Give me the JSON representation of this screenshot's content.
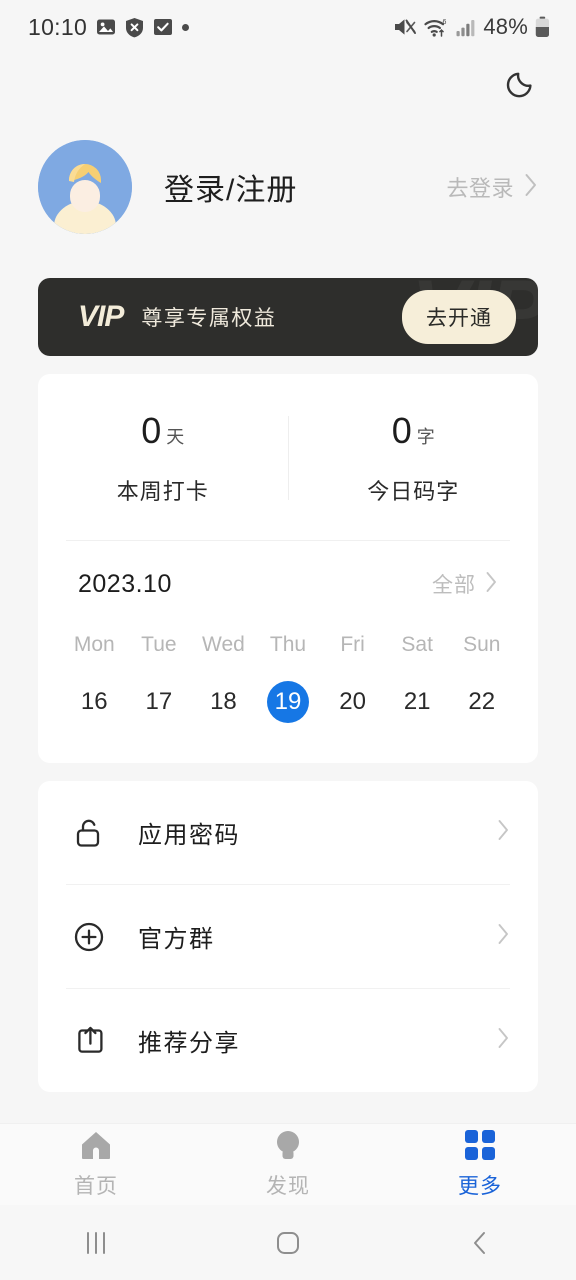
{
  "status_bar": {
    "time": "10:10",
    "left_icons": [
      "image-icon",
      "shield-x-icon",
      "checkbox-checked-icon",
      "dot-icon"
    ],
    "right_icons": [
      "mute-icon",
      "wifi6-icon",
      "signal-bars-icon",
      "battery-icon"
    ],
    "battery_text": "48%"
  },
  "header": {
    "theme_toggle_icon": "moon-icon"
  },
  "profile": {
    "avatar_icon": "default-user-avatar",
    "name": "登录/注册",
    "action_label": "去登录",
    "chevron_icon": "chevron-right-icon"
  },
  "vip": {
    "logo": "VIP",
    "watermark": "VIP",
    "subtitle": "尊享专属权益",
    "button_label": "去开通",
    "bg_color": "#2e2e2c",
    "button_color": "#f6eed9"
  },
  "stats": [
    {
      "value": "0",
      "unit": "天",
      "label": "本周打卡"
    },
    {
      "value": "0",
      "unit": "字",
      "label": "今日码字"
    }
  ],
  "calendar": {
    "month": "2023.10",
    "all_label": "全部",
    "all_chevron_icon": "chevron-right-icon",
    "weekdays": [
      "Mon",
      "Tue",
      "Wed",
      "Thu",
      "Fri",
      "Sat",
      "Sun"
    ],
    "days": [
      "16",
      "17",
      "18",
      "19",
      "20",
      "21",
      "22"
    ],
    "selected_day": "19",
    "selected_color": "#1677e5"
  },
  "menu": [
    {
      "icon": "lock-open-icon",
      "label": "应用密码",
      "chevron": "chevron-right-icon"
    },
    {
      "icon": "plus-circle-icon",
      "label": "官方群",
      "chevron": "chevron-right-icon"
    },
    {
      "icon": "share-icon",
      "label": "推荐分享",
      "chevron": "chevron-right-icon"
    }
  ],
  "tabbar": {
    "active_color": "#1a63d8",
    "items": [
      {
        "icon": "home-icon",
        "label": "首页",
        "active": false
      },
      {
        "icon": "lightbulb-icon",
        "label": "发现",
        "active": false
      },
      {
        "icon": "grid-icon",
        "label": "更多",
        "active": true
      }
    ]
  },
  "android_nav": {
    "recents_icon": "recents-icon",
    "home_icon": "home-square-icon",
    "back_icon": "back-chevron-icon"
  }
}
